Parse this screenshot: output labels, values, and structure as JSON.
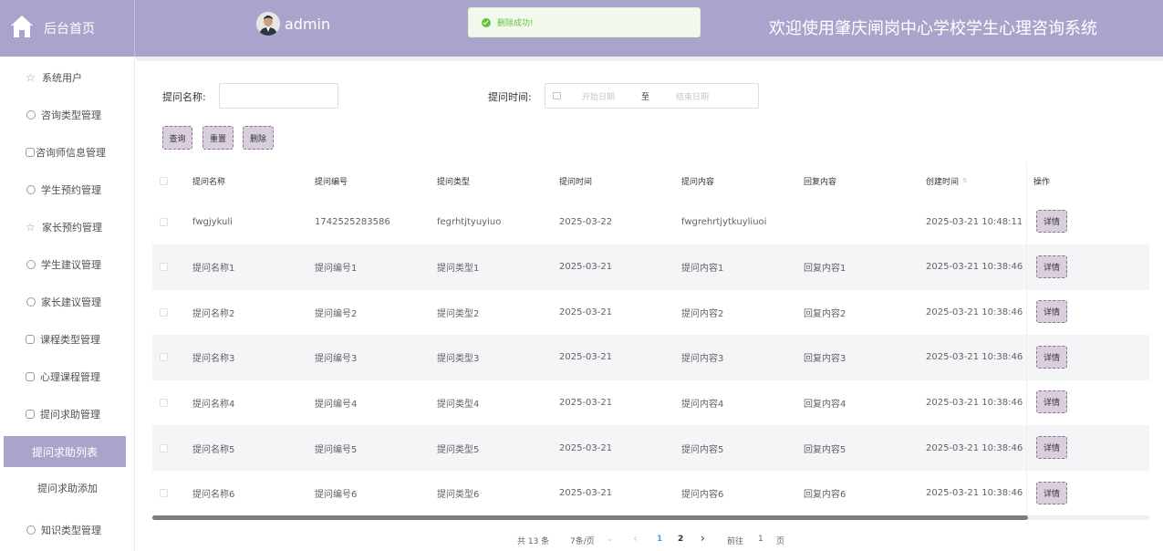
{
  "header": {
    "home_label": "后台首页",
    "username": "admin",
    "toast": "删除成功!",
    "system_title": "欢迎使用肇庆闸岗中心学校学生心理咨询系统"
  },
  "sidebar": {
    "items": [
      {
        "label": "系统用户"
      },
      {
        "label": "咨询类型管理"
      },
      {
        "label": "咨询师信息管理"
      },
      {
        "label": "学生预约管理"
      },
      {
        "label": "家长预约管理"
      },
      {
        "label": "学生建议管理"
      },
      {
        "label": "家长建议管理"
      },
      {
        "label": "课程类型管理"
      },
      {
        "label": "心理课程管理"
      },
      {
        "label": "提问求助管理"
      },
      {
        "label": "提问求助列表"
      },
      {
        "label": "提问求助添加"
      },
      {
        "label": "知识类型管理"
      }
    ]
  },
  "filters": {
    "name_label": "提问名称:",
    "name_value": "",
    "time_label": "提问时间:",
    "start_placeholder": "开始日期",
    "range_sep": "至",
    "end_placeholder": "结束日期"
  },
  "buttons": {
    "query": "查询",
    "reset": "重置",
    "delete": "删除"
  },
  "table": {
    "columns": [
      "提问名称",
      "提问编号",
      "提问类型",
      "提问时间",
      "提问内容",
      "回复内容",
      "创建时间",
      "操作"
    ],
    "sort_icon": "⇅",
    "detail_label": "详情",
    "rows": [
      [
        "fwgjykuli",
        "1742525283586",
        "fegrhtjtyuyiuo",
        "2025-03-22",
        "fwgrehrtjytkuyliuoi",
        "",
        "2025-03-21 10:48:11"
      ],
      [
        "提问名称1",
        "提问编号1",
        "提问类型1",
        "2025-03-21",
        "提问内容1",
        "回复内容1",
        "2025-03-21 10:38:46"
      ],
      [
        "提问名称2",
        "提问编号2",
        "提问类型2",
        "2025-03-21",
        "提问内容2",
        "回复内容2",
        "2025-03-21 10:38:46"
      ],
      [
        "提问名称3",
        "提问编号3",
        "提问类型3",
        "2025-03-21",
        "提问内容3",
        "回复内容3",
        "2025-03-21 10:38:46"
      ],
      [
        "提问名称4",
        "提问编号4",
        "提问类型4",
        "2025-03-21",
        "提问内容4",
        "回复内容4",
        "2025-03-21 10:38:46"
      ],
      [
        "提问名称5",
        "提问编号5",
        "提问类型5",
        "2025-03-21",
        "提问内容5",
        "回复内容5",
        "2025-03-21 10:38:46"
      ],
      [
        "提问名称6",
        "提问编号6",
        "提问类型6",
        "2025-03-21",
        "提问内容6",
        "回复内容6",
        "2025-03-21 10:38:46"
      ]
    ]
  },
  "pagination": {
    "total": "共 13 条",
    "page_size": "7条/页",
    "size_arrow": "⌄",
    "prev": "‹",
    "page1": "1",
    "page2": "2",
    "next": "›",
    "goto_label": "前往",
    "goto_value": "1",
    "page_suffix": "页"
  },
  "colors": {
    "primary": "#a9a4cc",
    "button_bg": "#d9cfdc",
    "success": "#67c23a"
  }
}
